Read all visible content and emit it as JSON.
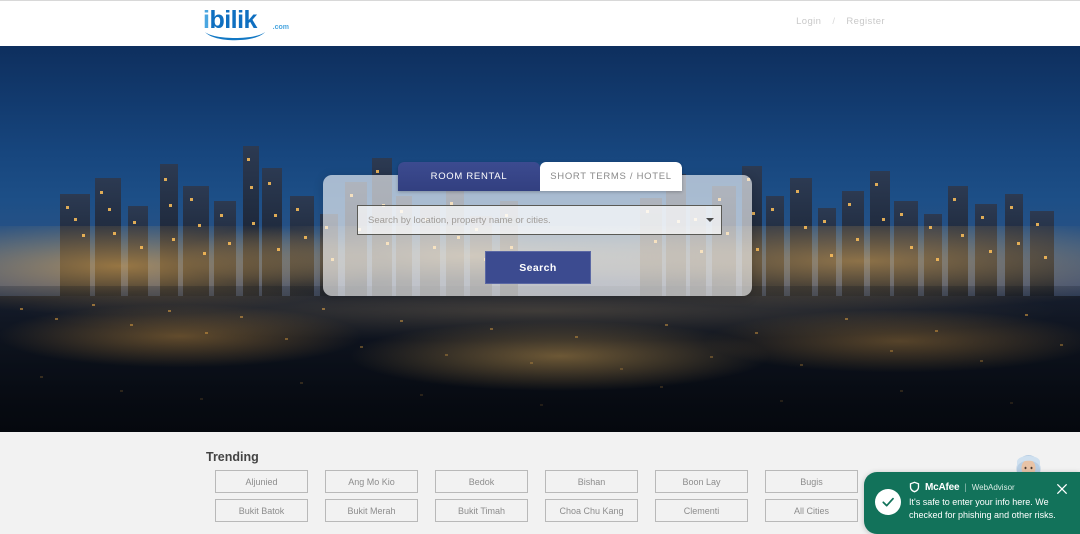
{
  "header": {
    "logo": {
      "text_primary": "i",
      "text_rest": "bilik",
      "suffix": ".com",
      "icon": "ibilik-logo"
    },
    "login_label": "Login",
    "separator": "/",
    "register_label": "Register"
  },
  "hero": {
    "image_alt": "night-city-skyline",
    "tabs": [
      {
        "label": "ROOM RENTAL",
        "active": true
      },
      {
        "label": "SHORT TERMS / HOTEL",
        "active": false
      }
    ],
    "search": {
      "placeholder": "Search by location, property name or cities.",
      "value": "",
      "dropdown_icon": "chevron-down-icon",
      "button_label": "Search"
    }
  },
  "trending": {
    "title": "Trending",
    "tags": [
      "Aljunied",
      "Ang Mo Kio",
      "Bedok",
      "Bishan",
      "Boon Lay",
      "Bugis",
      "Bukit Batok",
      "Bukit Merah",
      "Bukit Timah",
      "Choa Chu Kang",
      "Clementi",
      "All Cities"
    ]
  },
  "notification": {
    "brand": "McAfee",
    "divider": "|",
    "product": "WebAdvisor",
    "message": "It's safe to enter your info here. We checked for phishing and other risks.",
    "close_icon": "close-icon",
    "status_icon": "check-circle-icon",
    "shield_icon": "shield-icon",
    "avatar_icon": "user-avatar"
  },
  "colors": {
    "brand_blue": "#0f6fc0",
    "accent_navy": "#3c4b90",
    "mcafee_green": "#12725a",
    "panel_gray": "#f2f2f2"
  }
}
